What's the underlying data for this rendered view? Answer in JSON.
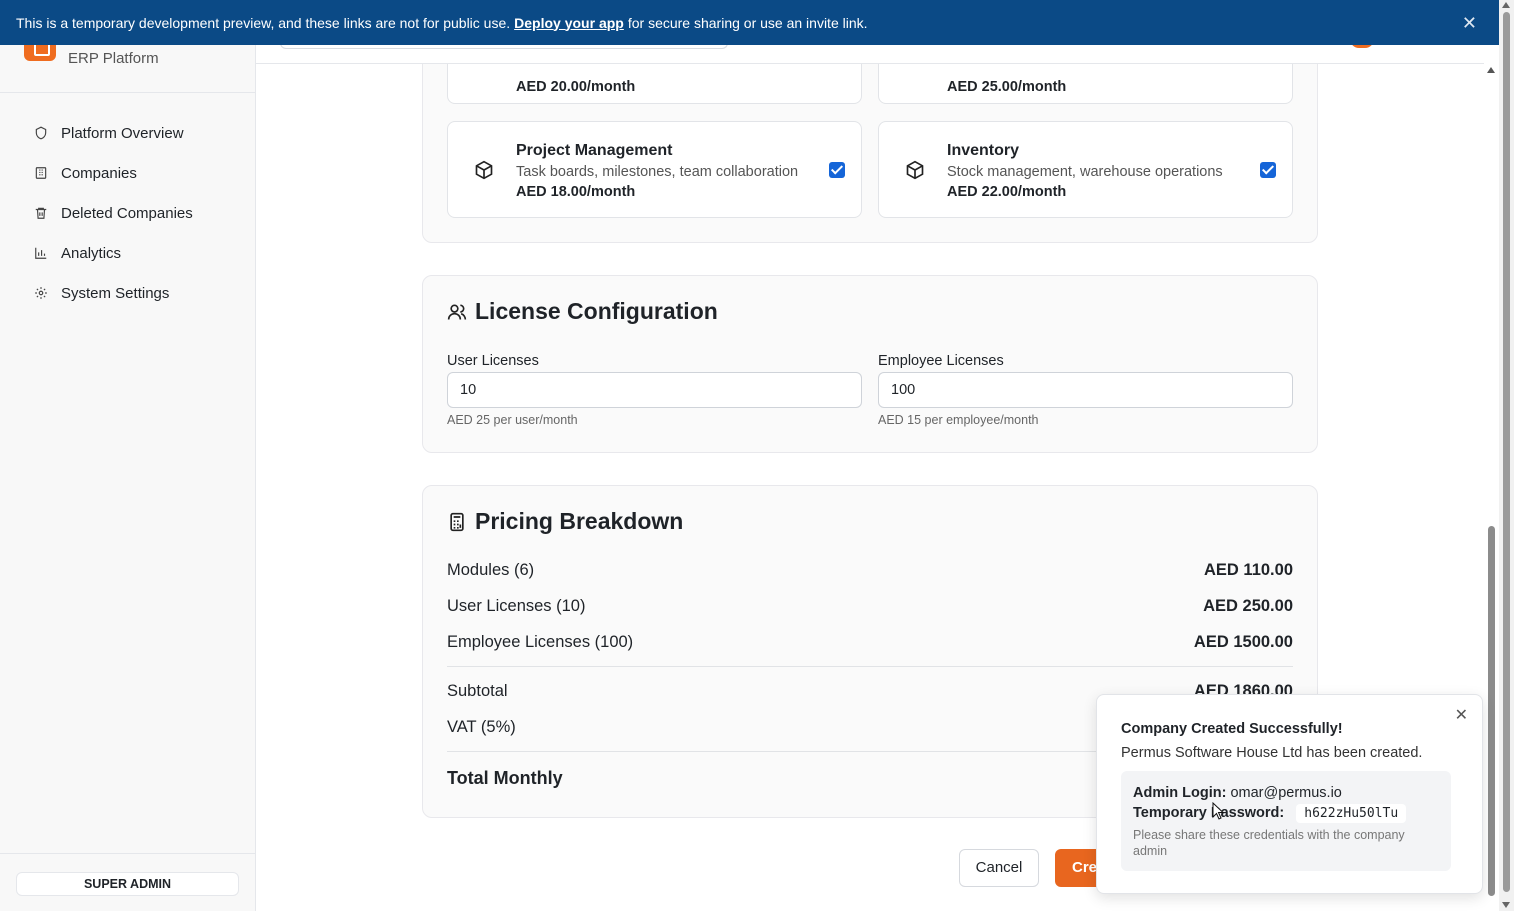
{
  "banner": {
    "text_before": "This is a temporary development preview, and these links are not for public use.",
    "link": "Deploy your app",
    "text_after": "for secure sharing or use an invite link.",
    "close_icon": "close-icon"
  },
  "sidebar": {
    "brand_subtitle": "ERP Platform",
    "items": [
      {
        "label": "Platform Overview",
        "icon": "shield-icon"
      },
      {
        "label": "Companies",
        "icon": "building-icon"
      },
      {
        "label": "Deleted Companies",
        "icon": "trash-icon"
      },
      {
        "label": "Analytics",
        "icon": "bar-chart-icon"
      },
      {
        "label": "System Settings",
        "icon": "gear-icon"
      }
    ],
    "role": "SUPER ADMIN"
  },
  "modules": {
    "top_left_price": "AED 20.00/month",
    "top_right_price": "AED 25.00/month",
    "project": {
      "title": "Project Management",
      "desc": "Task boards, milestones, team collaboration",
      "price": "AED 18.00/month"
    },
    "inventory": {
      "title": "Inventory",
      "desc": "Stock management, warehouse operations",
      "price": "AED 22.00/month"
    }
  },
  "license": {
    "title": "License Configuration",
    "user_label": "User Licenses",
    "user_value": "10",
    "user_hint": "AED 25 per user/month",
    "employee_label": "Employee Licenses",
    "employee_value": "100",
    "employee_hint": "AED 15 per employee/month"
  },
  "pricing": {
    "title": "Pricing Breakdown",
    "rows": [
      {
        "label": "Modules (6)",
        "amount": "AED 110.00"
      },
      {
        "label": "User Licenses (10)",
        "amount": "AED 250.00"
      },
      {
        "label": "Employee Licenses (100)",
        "amount": "AED 1500.00"
      }
    ],
    "subtotal_label": "Subtotal",
    "subtotal_amount": "AED 1860.00",
    "vat_label": "VAT (5%)",
    "total_label": "Total Monthly"
  },
  "actions": {
    "cancel": "Cancel",
    "create": "Cre"
  },
  "toast": {
    "title": "Company Created Successfully!",
    "message": "Permus Software House Ltd has been created.",
    "admin_login_label": "Admin Login:",
    "admin_login_value": "omar@permus.io",
    "password_label": "Temporary Password:",
    "password_value": "h622zHu50lTu",
    "note": "Please share these credentials with the company admin"
  },
  "colors": {
    "banner": "#0b4a86",
    "accent": "#e8661f",
    "checkbox": "#1565d8"
  }
}
